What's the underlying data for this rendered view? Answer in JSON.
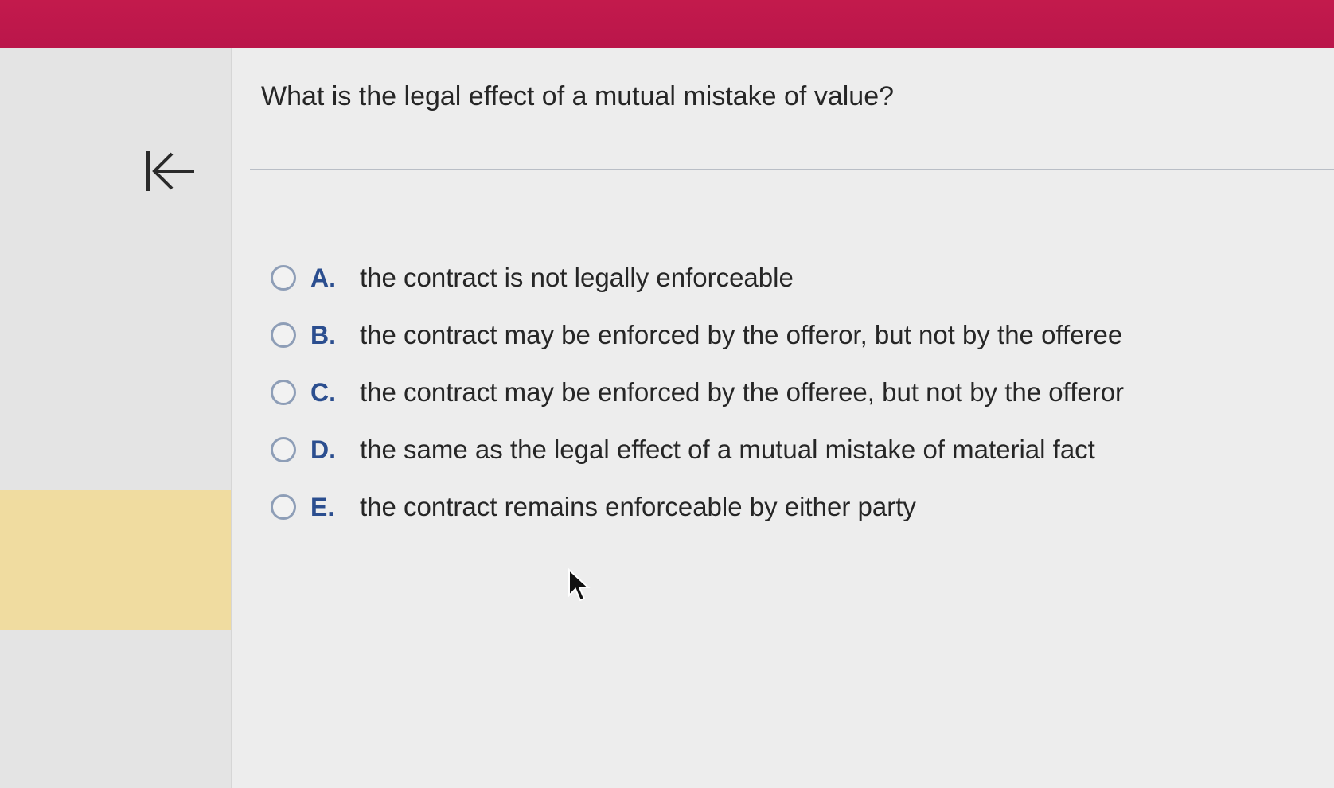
{
  "header": {
    "accent_color": "#c31a4c"
  },
  "sidebar": {
    "collapse_icon": "collapse-left-arrow-icon",
    "highlight_color": "#f0dca0"
  },
  "question": {
    "text": "What is the legal effect of a mutual mistake of value?"
  },
  "options": [
    {
      "letter": "A.",
      "text": "the contract is not legally enforceable",
      "selected": false
    },
    {
      "letter": "B.",
      "text": "the contract may be enforced by the offeror, but not by the offeree",
      "selected": false
    },
    {
      "letter": "C.",
      "text": "the contract may be enforced by the offeree, but not by the offeror",
      "selected": false
    },
    {
      "letter": "D.",
      "text": "the same as the legal effect of a mutual mistake of material fact",
      "selected": false
    },
    {
      "letter": "E.",
      "text": "the contract remains enforceable by either party",
      "selected": false
    }
  ]
}
